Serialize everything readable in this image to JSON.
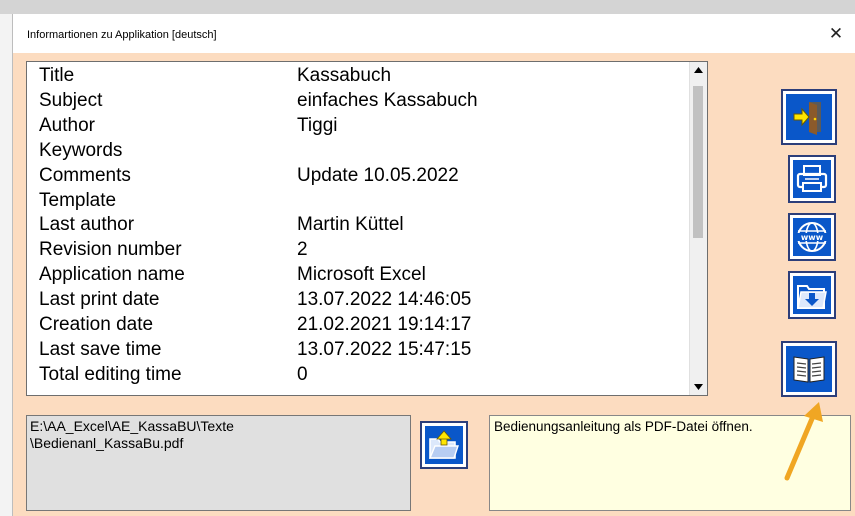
{
  "window": {
    "title": "Informartionen zu Applikation   [deutsch]",
    "close_glyph": "✕"
  },
  "properties": [
    {
      "key": "Title",
      "value": "Kassabuch"
    },
    {
      "key": "Subject",
      "value": "einfaches Kassabuch"
    },
    {
      "key": "Author",
      "value": "Tiggi"
    },
    {
      "key": "Keywords",
      "value": ""
    },
    {
      "key": "Comments",
      "value": "Update 10.05.2022"
    },
    {
      "key": "Template",
      "value": ""
    },
    {
      "key": "Last author",
      "value": "Martin Küttel"
    },
    {
      "key": "Revision number",
      "value": "2"
    },
    {
      "key": "Application name",
      "value": "Microsoft Excel"
    },
    {
      "key": "Last print date",
      "value": "13.07.2022 14:46:05"
    },
    {
      "key": "Creation date",
      "value": "21.02.2021 19:14:17"
    },
    {
      "key": "Last save time",
      "value": "13.07.2022 15:47:15"
    },
    {
      "key": "Total editing time",
      "value": "0"
    }
  ],
  "side_buttons": [
    {
      "name": "exit-button",
      "icon": "exit-door-icon"
    },
    {
      "name": "print-button",
      "icon": "printer-icon"
    },
    {
      "name": "web-button",
      "icon": "www-globe-icon"
    },
    {
      "name": "save-folder-button",
      "icon": "folder-download-icon"
    },
    {
      "name": "manual-button",
      "icon": "open-book-icon"
    }
  ],
  "path_box": {
    "line1": "E:\\AA_Excel\\AE_KassaBU\\Texte",
    "line2": "\\Bedienanl_KassaBu.pdf"
  },
  "open_folder_button": {
    "icon": "open-folder-up-icon"
  },
  "description": "Bedienungsanleitung als PDF-Datei öffnen.",
  "colors": {
    "dialog_background": "#fcdcc0",
    "button_blue": "#0a57c9",
    "annotation_arrow": "#f0a623",
    "description_background": "#ffffe1"
  }
}
